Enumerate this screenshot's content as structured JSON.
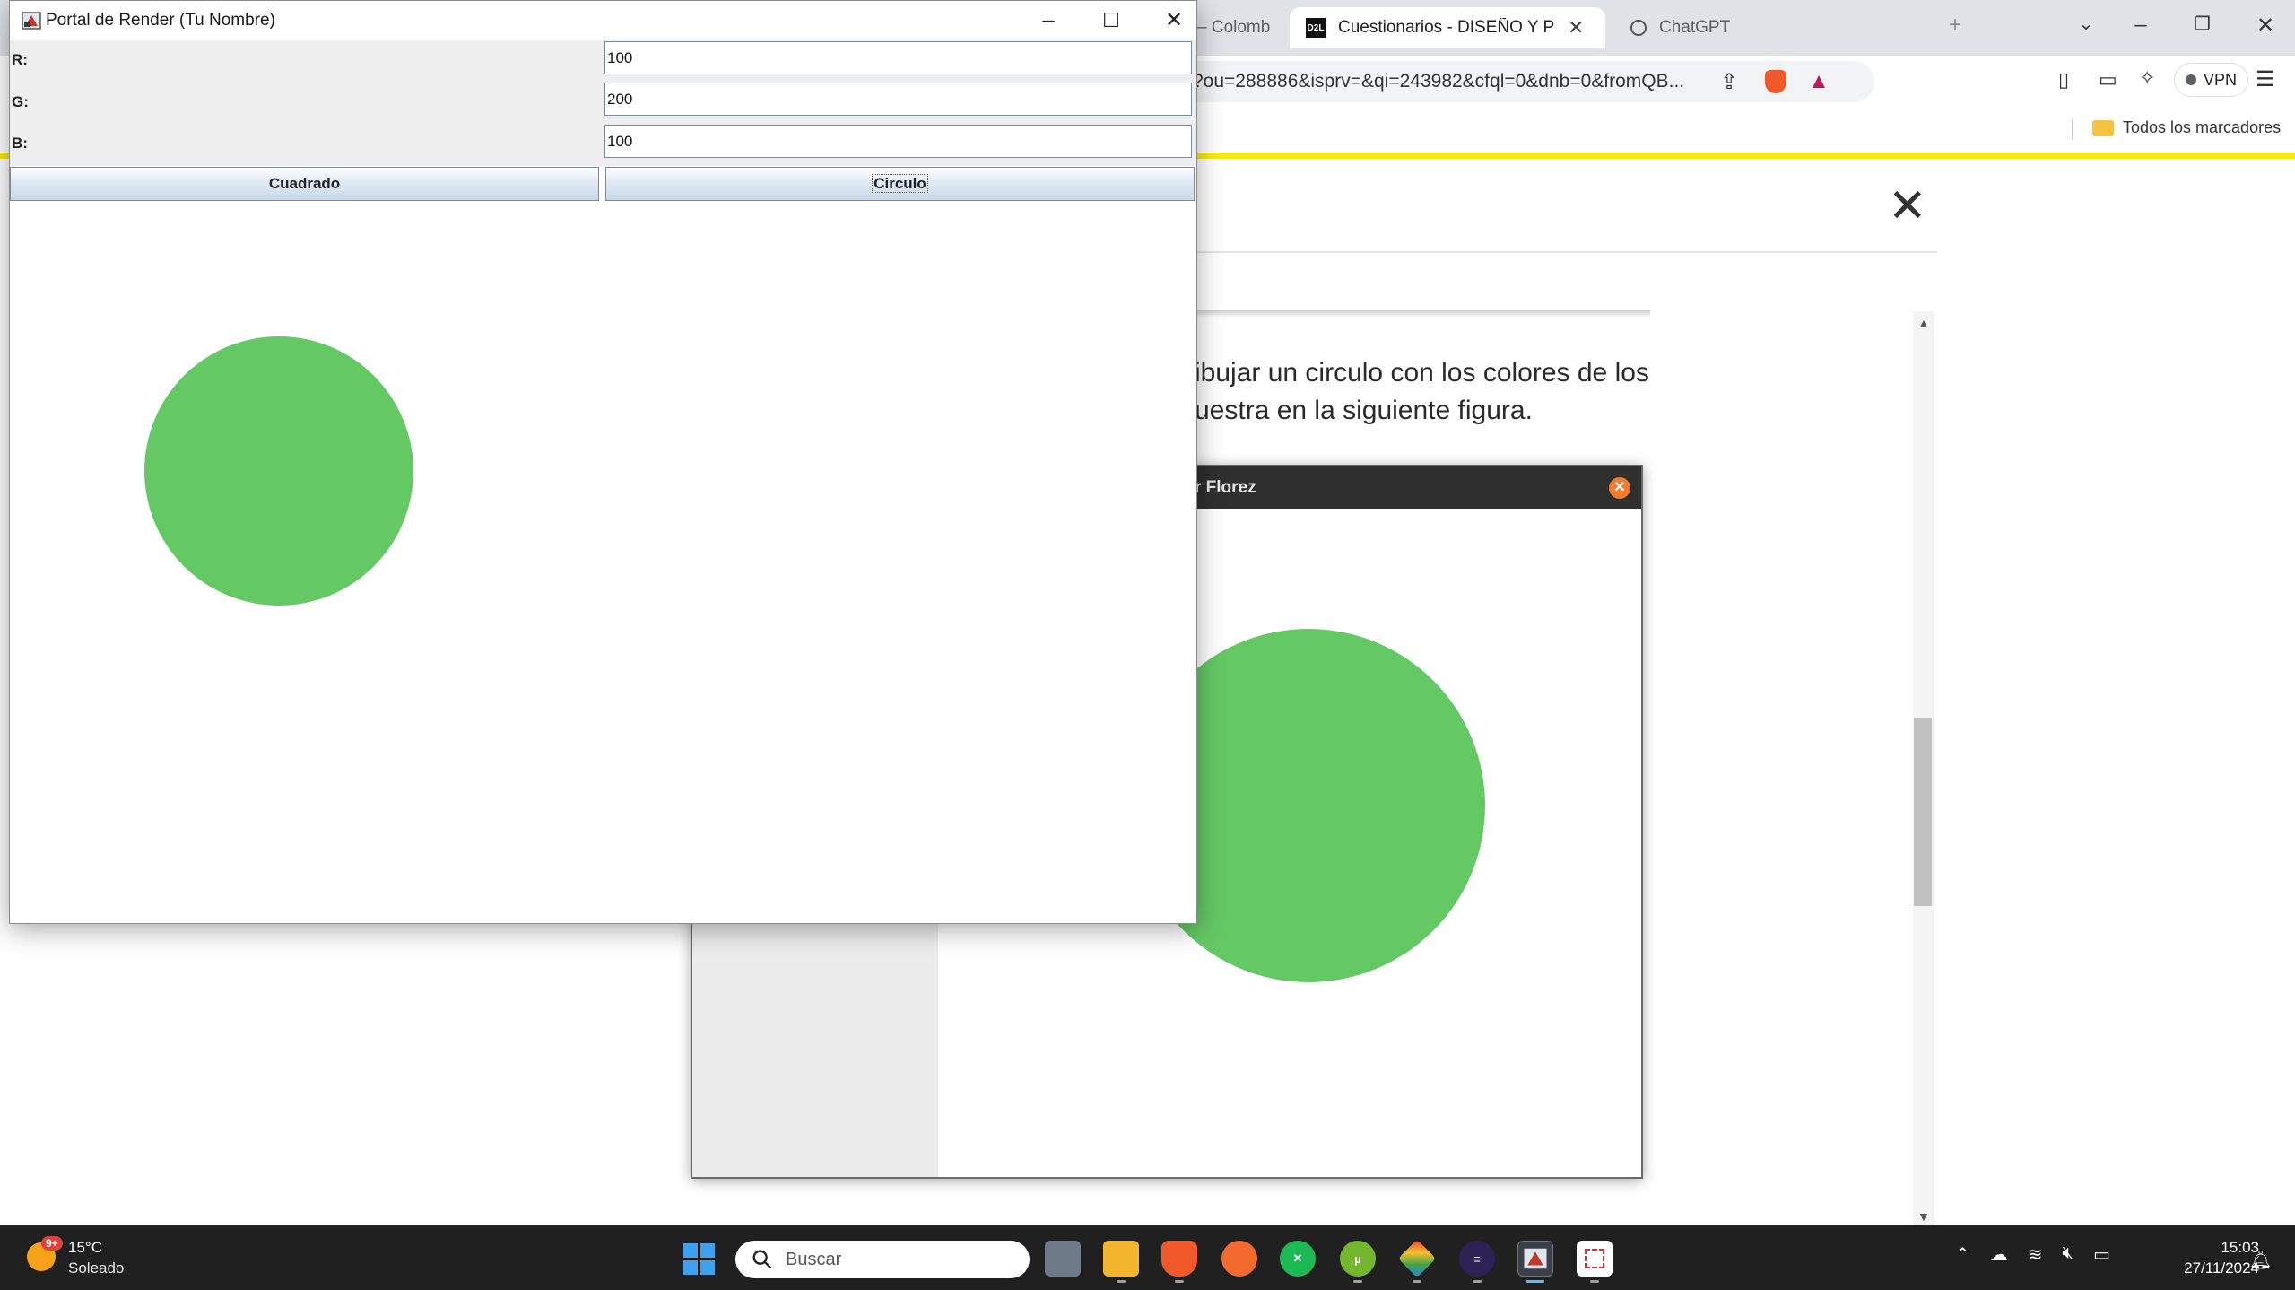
{
  "browser": {
    "tabs": [
      {
        "title": "– Colomb",
        "active": false
      },
      {
        "title": "Cuestionarios - DISEÑO Y PRO",
        "active": true,
        "favicon_text": "D2L"
      },
      {
        "title": "ChatGPT",
        "active": false
      }
    ],
    "new_tab": "+",
    "url_fragment": "?ou=288886&isprv=&qi=243982&cfql=0&dnb=0&fromQB...",
    "vpn_label": "VPN",
    "bookmarks_label": "Todos los marcadores"
  },
  "page": {
    "text_line1": "ibujar un circulo con los colores de los",
    "text_line2": "uestra en la siguiente figura.",
    "figure_title": "r Florez"
  },
  "app": {
    "title": "Portal de Render (Tu Nombre)",
    "fields": [
      {
        "label": "R:",
        "value": "100"
      },
      {
        "label": "G:",
        "value": "200"
      },
      {
        "label": "B:",
        "value": "100"
      }
    ],
    "buttons": {
      "square": "Cuadrado",
      "circle": "Circulo"
    },
    "render_color": "#64c864"
  },
  "taskbar": {
    "weather_temp": "15°C",
    "weather_condition": "Soleado",
    "weather_badge": "9+",
    "search_placeholder": "Buscar",
    "time": "15:03",
    "date": "27/11/2024"
  },
  "colors": {
    "circle_green": "#64c864",
    "bookmark_stripe": "#f5ea18",
    "taskbar": "#202020"
  }
}
